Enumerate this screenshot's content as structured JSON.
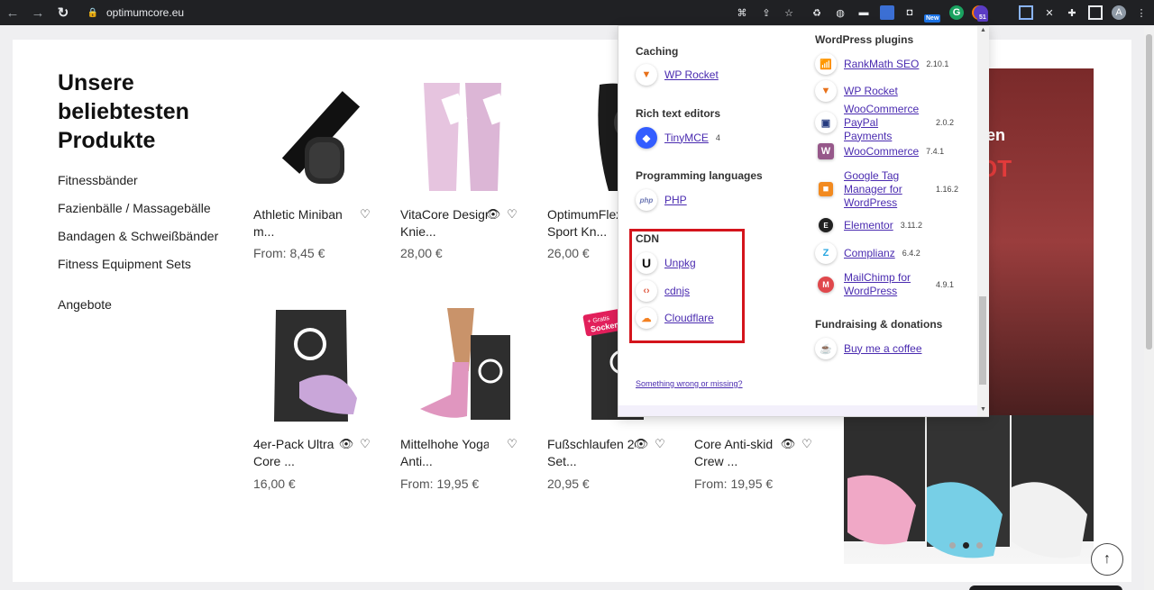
{
  "browser": {
    "url": "optimumcore.eu",
    "ext_badge_new": "New",
    "ext_badge_count": "51",
    "profile_initial": "A"
  },
  "heading": "Unsere beliebtesten Produkte",
  "categories": [
    "Fitnessbänder",
    "Fazienbälle / Massagebälle",
    "Bandagen & Schweißbänder",
    "Fitness Equipment Sets",
    "Angebote"
  ],
  "products": [
    {
      "name": "Athletic Minibands",
      "name2": "m...",
      "price": "From: 8,45 €"
    },
    {
      "name": "VitaCore Design",
      "name2": "Knie...",
      "price": "28,00 €"
    },
    {
      "name": "OptimumFlex",
      "name2": "Sport Kn...",
      "price": "26,00 €"
    },
    {
      "name": "4er-Pack Ultra",
      "name2": "Core ...",
      "price": "16,00 €"
    },
    {
      "name": "Mittelhohe Yoga",
      "name2": "Anti...",
      "price": "From: 19,95 €"
    },
    {
      "name": "Fußschlaufen 2er",
      "name2": "Set...",
      "price": "20,95 €"
    },
    {
      "name": "Core Anti-skid",
      "name2": "Crew ...",
      "price": "From: 19,95 €"
    }
  ],
  "promo": {
    "text1": "ken",
    "text2": "OT",
    "badge_line1": "+ Gratis",
    "badge_line2": "Socken"
  },
  "carousel": {
    "slides": 3,
    "active": 2
  },
  "popup": {
    "left": [
      {
        "title": "Caching",
        "items": [
          {
            "name": "WP Rocket",
            "version": "",
            "icon": "wp-rocket-icon"
          }
        ]
      },
      {
        "title": "Rich text editors",
        "items": [
          {
            "name": "TinyMCE",
            "version": "4",
            "icon": "tinymce-icon"
          }
        ]
      },
      {
        "title": "Programming languages",
        "items": [
          {
            "name": "PHP",
            "version": "",
            "icon": "php-icon"
          }
        ]
      },
      {
        "title": "CDN",
        "items": [
          {
            "name": "Unpkg",
            "version": "",
            "icon": "unpkg-icon"
          },
          {
            "name": "cdnjs",
            "version": "",
            "icon": "cdnjs-icon"
          },
          {
            "name": "Cloudflare",
            "version": "",
            "icon": "cloudflare-icon"
          }
        ]
      }
    ],
    "right": [
      {
        "title": "WordPress plugins",
        "items": [
          {
            "name": "RankMath SEO",
            "version": "2.10.1",
            "icon": "rankmath-icon"
          },
          {
            "name": "WP Rocket",
            "version": "",
            "icon": "wp-rocket-icon"
          },
          {
            "name": "WooCommerce PayPal Payments",
            "version": "2.0.2",
            "icon": "paypal-icon"
          },
          {
            "name": "WooCommerce",
            "version": "7.4.1",
            "icon": "woocommerce-icon"
          },
          {
            "name": "Google Tag Manager for WordPress",
            "version": "1.16.2",
            "icon": "gtm-icon"
          },
          {
            "name": "Elementor",
            "version": "3.11.2",
            "icon": "elementor-icon"
          },
          {
            "name": "Complianz",
            "version": "6.4.2",
            "icon": "complianz-icon"
          },
          {
            "name": "MailChimp for WordPress",
            "version": "4.9.1",
            "icon": "mailchimp-icon"
          }
        ]
      },
      {
        "title": "Fundraising & donations",
        "items": [
          {
            "name": "Buy me a coffee",
            "version": "",
            "icon": "coffee-icon"
          }
        ]
      }
    ],
    "footer_link": "Something wrong or missing?",
    "colors": {
      "link": "#4a2bb0",
      "highlight_box": "#d4141c"
    }
  }
}
